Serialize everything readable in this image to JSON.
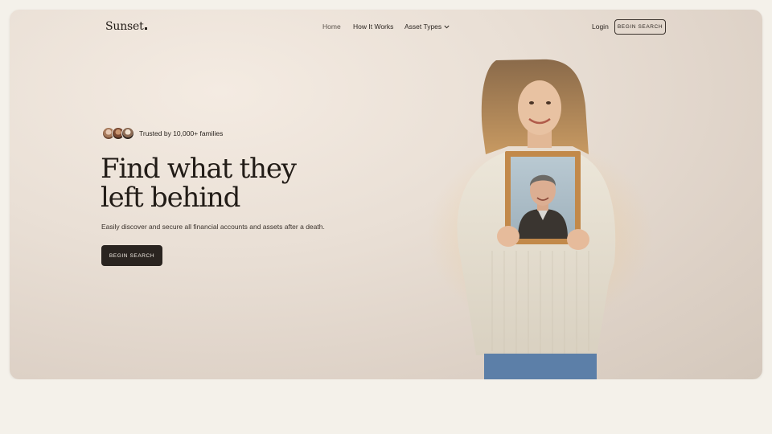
{
  "nav": {
    "logo": "Sunset",
    "links": [
      {
        "label": "Home"
      },
      {
        "label": "How It Works"
      },
      {
        "label": "Asset Types"
      }
    ],
    "login": "Login",
    "cta": "BEGIN SEARCH"
  },
  "hero": {
    "trust_text": "Trusted by 10,000+ families",
    "headline_line1": "Find what they",
    "headline_line2": "left behind",
    "subtext": "Easily discover and secure all financial accounts and assets after a death.",
    "cta": "BEGIN SEARCH"
  },
  "colors": {
    "background": "#f4f1ea",
    "hero_bg": "#e9dfd5",
    "primary_dark": "#2a2420",
    "text": "#2b2520"
  },
  "icons": {
    "dropdown": "chevron-down-icon"
  }
}
